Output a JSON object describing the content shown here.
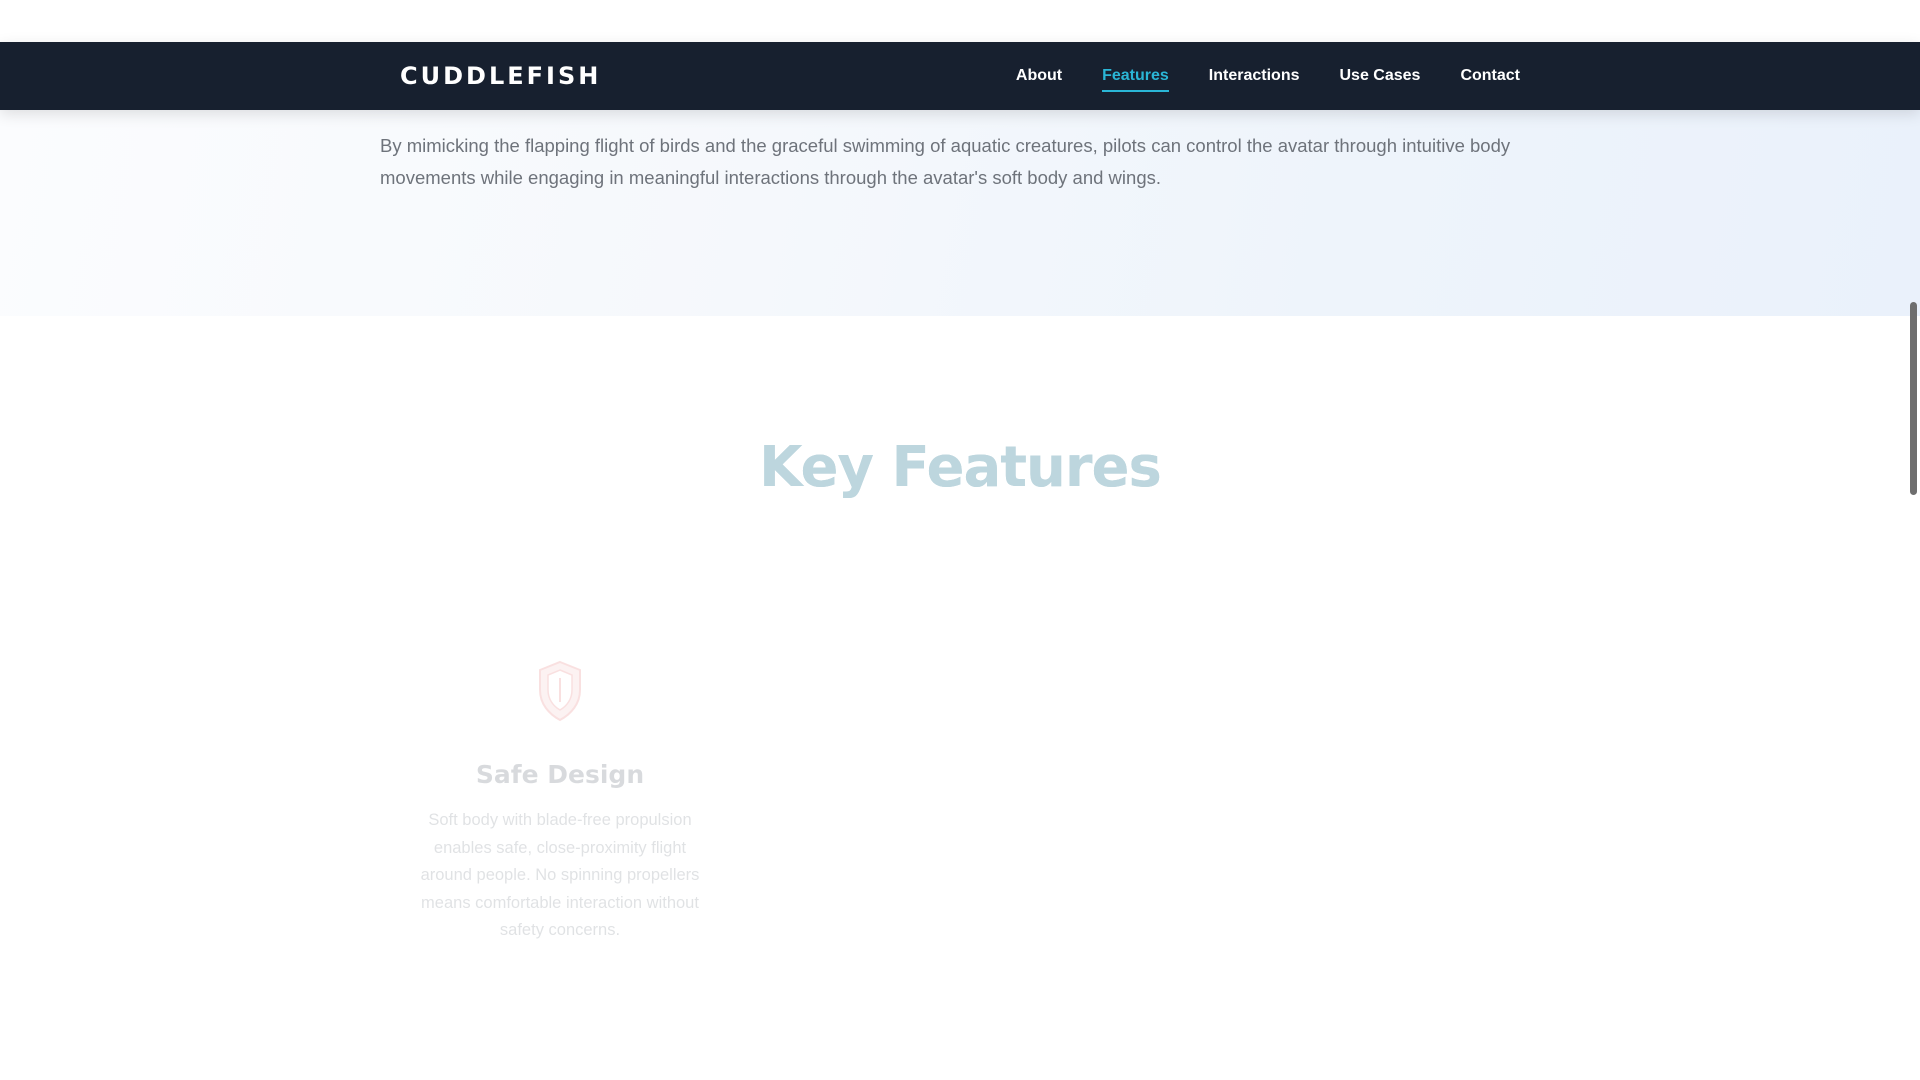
{
  "navbar": {
    "logo": "CUDDLEFISH",
    "links": [
      {
        "label": "About"
      },
      {
        "label": "Features"
      },
      {
        "label": "Interactions"
      },
      {
        "label": "Use Cases"
      },
      {
        "label": "Contact"
      }
    ],
    "active_link": "Features",
    "background_color": "#17202f",
    "active_color": "#2ab6d6"
  },
  "intro": {
    "text": "By mimicking the flapping flight of birds and the graceful swimming of aquatic creatures, pilots can control the avatar through intuitive body movements while engaging in meaningful interactions through the avatar's soft body and wings."
  },
  "features_section": {
    "title": "Key Features",
    "items": [
      {
        "icon": "shield-icon",
        "title": "Safe Design",
        "description": "Soft body with blade-free propulsion enables safe, close-proximity flight around people. No spinning propellers means comfortable interaction without safety concerns."
      }
    ]
  }
}
